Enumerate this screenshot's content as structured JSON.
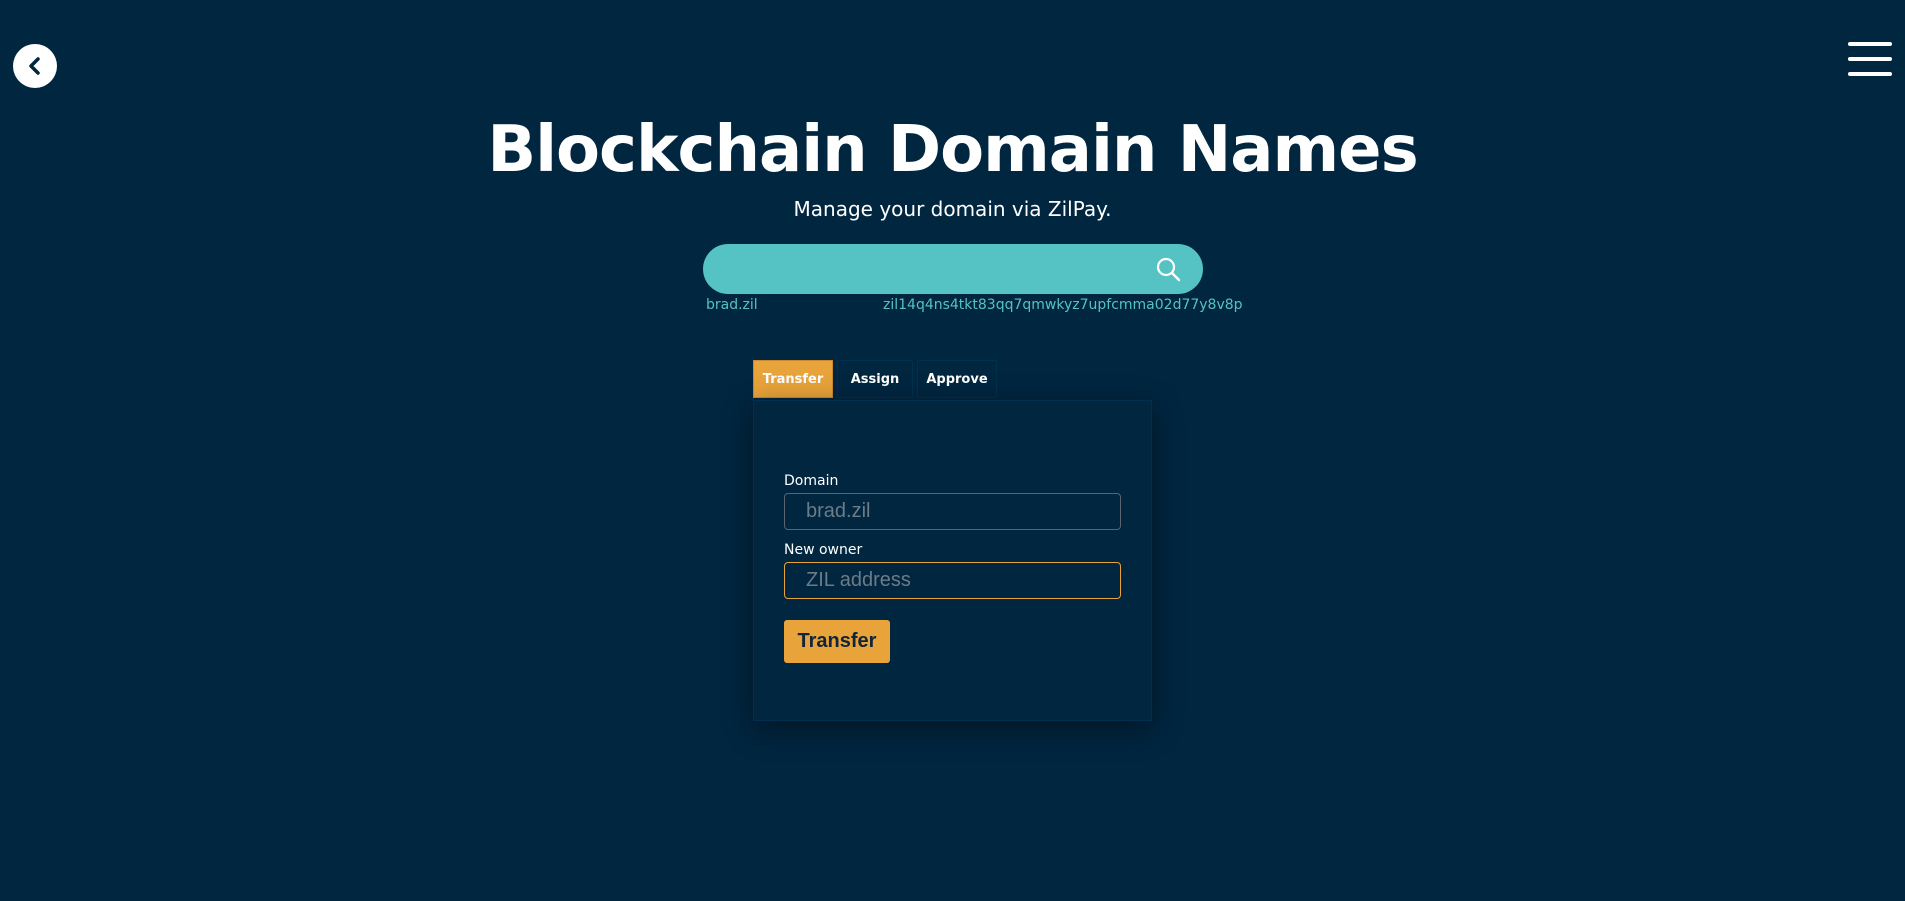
{
  "header": {
    "back_icon": "chevron-left-icon",
    "menu_icon": "hamburger-menu-icon"
  },
  "hero": {
    "title": "Blockchain Domain Names",
    "subtitle": "Manage your domain via ZilPay."
  },
  "search": {
    "value": "",
    "icon": "search-icon",
    "domain": "brad.zil",
    "address": "zil14q4ns4tkt83qq7qmwkyz7upfcmma02d77y8v8p"
  },
  "tabs": [
    {
      "label": "Transfer",
      "active": true
    },
    {
      "label": "Assign",
      "active": false
    },
    {
      "label": "Approve",
      "active": false
    }
  ],
  "form": {
    "domain_label": "Domain",
    "domain_placeholder": "brad.zil",
    "owner_label": "New owner",
    "owner_placeholder": "ZIL address",
    "submit_label": "Transfer"
  },
  "colors": {
    "background": "#002640",
    "accent": "#e8a33a",
    "search_bg": "#55c2c4",
    "meta_text": "#55c2c4"
  }
}
